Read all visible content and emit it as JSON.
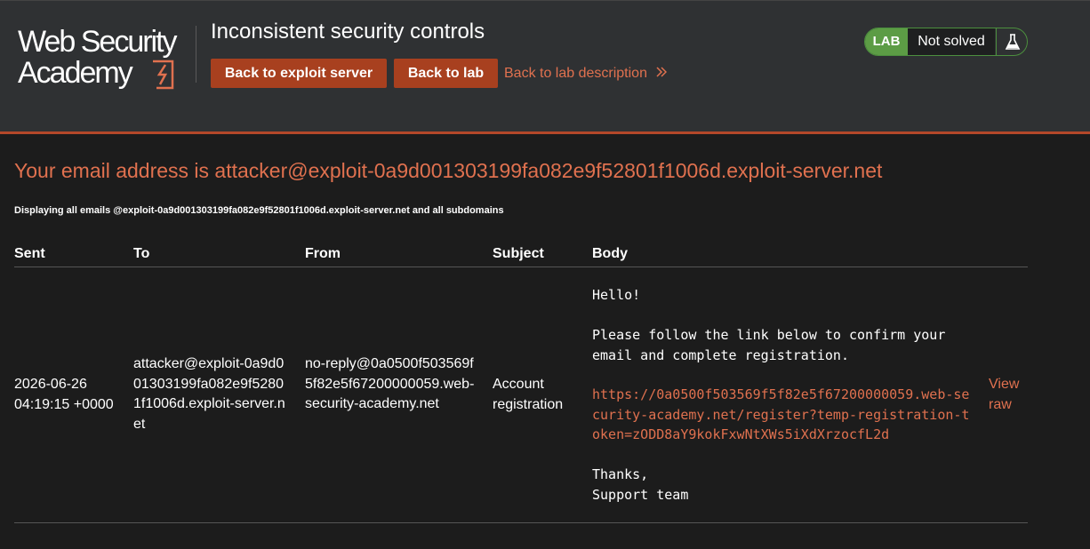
{
  "header": {
    "logo_line1": "Web Security",
    "logo_line2": "Academy",
    "lab_title": "Inconsistent security controls",
    "back_exploit_label": "Back to exploit server",
    "back_lab_label": "Back to lab",
    "back_desc_label": "Back to lab description",
    "status_badge": "LAB",
    "status_text": "Not solved",
    "accent_color": "#e0714f",
    "button_color": "#a8401f",
    "status_color": "#5c9c45"
  },
  "main": {
    "email_heading": "Your email address is attacker@exploit-0a9d001303199fa082e9f52801f1006d.exploit-server.net",
    "display_note": "Displaying all emails @exploit-0a9d001303199fa082e9f52801f1006d.exploit-server.net and all subdomains",
    "table": {
      "headers": [
        "Sent",
        "To",
        "From",
        "Subject",
        "Body"
      ],
      "rows": [
        {
          "sent": "2026-06-26 04:19:15 +0000",
          "to": "attacker@exploit-0a9d001303199fa082e9f52801f1006d.exploit-server.net",
          "from": "no-reply@0a0500f503569f5f82e5f67200000059.web-security-academy.net",
          "subject": "Account registration",
          "body_intro": "Hello!\n\nPlease follow the link below to confirm your\nemail and complete registration.",
          "body_link": "https://0a0500f503569f5f82e5f67200000059.web-security-academy.net/register?temp-registration-token=zODD8aY9kokFxwNtXWs5iXdXrzocfL2d",
          "body_outro": "Thanks,\nSupport team",
          "view_raw": "View raw"
        }
      ]
    }
  }
}
